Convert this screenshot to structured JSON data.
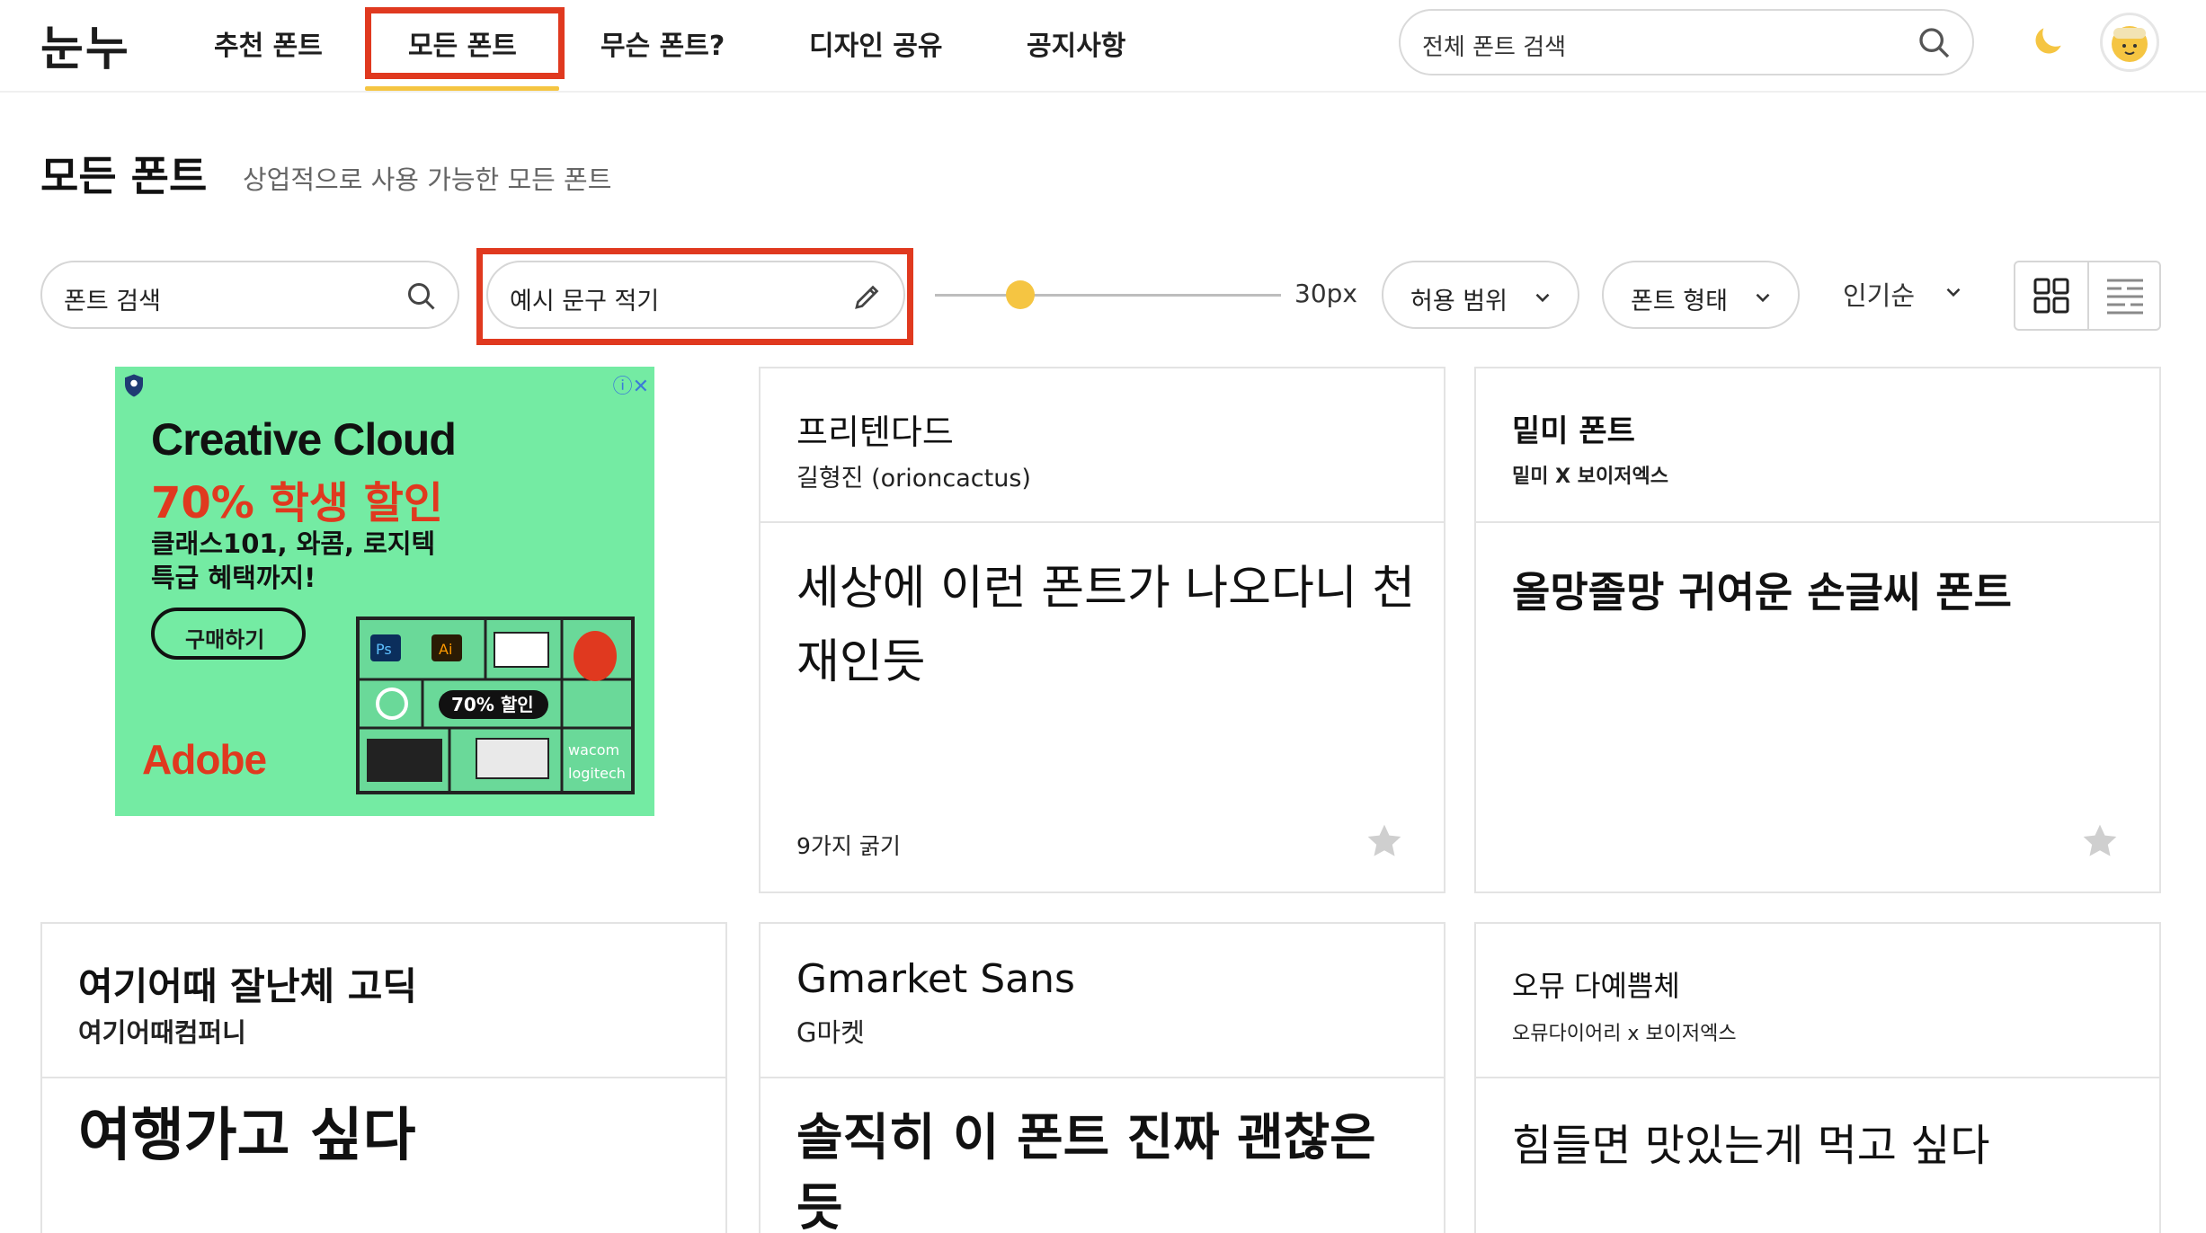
{
  "header": {
    "logo": "눈누",
    "nav": [
      "추천 폰트",
      "모든 폰트",
      "무슨 폰트?",
      "디자인 공유",
      "공지사항"
    ],
    "search_placeholder": "전체 폰트 검색"
  },
  "page": {
    "title": "모든 폰트",
    "subtitle": "상업적으로 사용 가능한 모든 폰트"
  },
  "filters": {
    "font_search_placeholder": "폰트 검색",
    "sample_text_placeholder": "예시 문구 적기",
    "font_size_value": "30px",
    "font_size_fraction": 0.2,
    "license_dropdown": "허용 범위",
    "shape_dropdown": "폰트 형태",
    "sort_label": "인기순"
  },
  "ad": {
    "headline": "Creative Cloud",
    "promo": "70% 학생 할인",
    "description": "클래스101, 와콤, 로지텍 특급 혜택까지!",
    "button": "구매하기",
    "brand": "Adobe",
    "badge": "70% 할인"
  },
  "cards": [
    {
      "name": "프리텐다드",
      "maker": "길형진 (orioncactus)",
      "sample": "세상에 이런 폰트가 나오다니 천재인듯",
      "weights": "9가지 굵기"
    },
    {
      "name": "밑미 폰트",
      "maker": "밑미 X 보이저엑스",
      "sample": "올망졸망 귀여운 손글씨 폰트",
      "weights": ""
    },
    {
      "name": "여기어때 잘난체 고딕",
      "maker": "여기어때컴퍼니",
      "sample": "여행가고 싶다"
    },
    {
      "name": "Gmarket Sans",
      "maker": "G마켓",
      "sample": "솔직히 이 폰트 진짜 괜찮은듯"
    },
    {
      "name": "오뮤 다예쁨체",
      "maker": "오뮤다이어리 x 보이저엑스",
      "sample": "힘들면 맛있는게 먹고 싶다"
    }
  ],
  "colors": {
    "accent": "#f5c542",
    "highlight": "#e0391f",
    "ad_background": "#74eba3"
  }
}
